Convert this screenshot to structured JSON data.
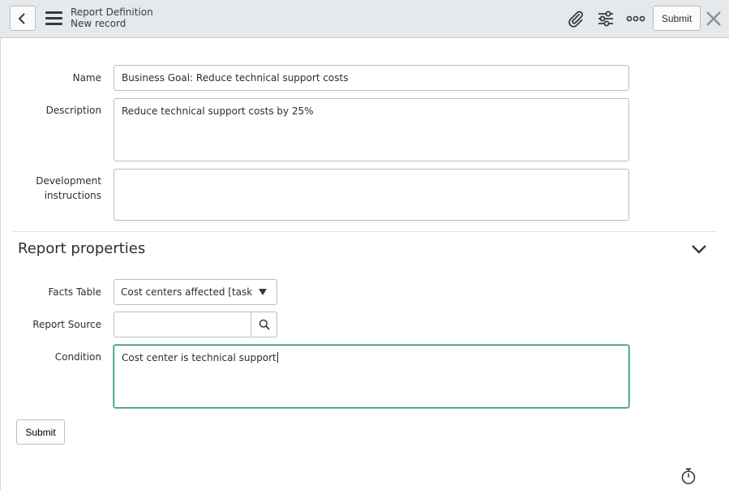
{
  "header": {
    "title": "Report Definition",
    "subtitle": "New record",
    "submit_label": "Submit",
    "icons": [
      "back-icon",
      "menu-icon",
      "paperclip-icon",
      "sliders-icon",
      "more-icon",
      "close-icon"
    ]
  },
  "form": {
    "name": {
      "label": "Name",
      "value": "Business Goal: Reduce technical support costs"
    },
    "description": {
      "label": "Description",
      "value": "Reduce technical support costs by 25%"
    },
    "dev_instructions": {
      "label_line1": "Development",
      "label_line2": "instructions",
      "value": ""
    },
    "section": {
      "title": "Report properties"
    },
    "facts_table": {
      "label": "Facts Table",
      "value": "Cost centers affected [task_..."
    },
    "report_source": {
      "label": "Report Source",
      "value": ""
    },
    "condition": {
      "label": "Condition",
      "value": "Cost center is technical support"
    },
    "submit_label": "Submit"
  },
  "colors": {
    "header_bg": "#e6e9eb",
    "focus_border": "#2a8a6f"
  }
}
